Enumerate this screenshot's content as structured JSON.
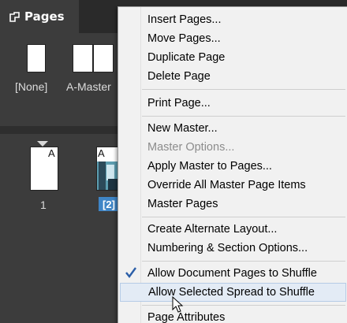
{
  "panel": {
    "tab_label": "Pages",
    "masters": [
      {
        "label": "[None]"
      },
      {
        "label": "A-Master"
      }
    ],
    "pages": [
      {
        "number": "1",
        "master_letter": "A"
      },
      {
        "number": "[2]",
        "master_letter": "A",
        "selected": true
      }
    ]
  },
  "menu": {
    "items": [
      {
        "label": "Insert Pages..."
      },
      {
        "label": "Move Pages..."
      },
      {
        "label": "Duplicate Page"
      },
      {
        "label": "Delete Page"
      },
      {
        "label": "Print Page..."
      },
      {
        "label": "New Master..."
      },
      {
        "label": "Master Options...",
        "disabled": true
      },
      {
        "label": "Apply Master to Pages..."
      },
      {
        "label": "Override All Master Page Items"
      },
      {
        "label": "Master Pages"
      },
      {
        "label": "Create Alternate Layout..."
      },
      {
        "label": "Numbering & Section Options..."
      },
      {
        "label": "Allow Document Pages to Shuffle",
        "checked": true
      },
      {
        "label": "Allow Selected Spread to Shuffle",
        "hovered": true
      },
      {
        "label": "Page Attributes"
      }
    ]
  },
  "colors": {
    "panel_bg": "#3c3c3c",
    "selection": "#3f85c6",
    "menu_bg": "#f1f1f1",
    "checkmark": "#2b5ea8"
  },
  "icons": {
    "checkmark": "check-icon",
    "cursor": "cursor-arrow-icon",
    "tab": "pages-panel-icon"
  }
}
